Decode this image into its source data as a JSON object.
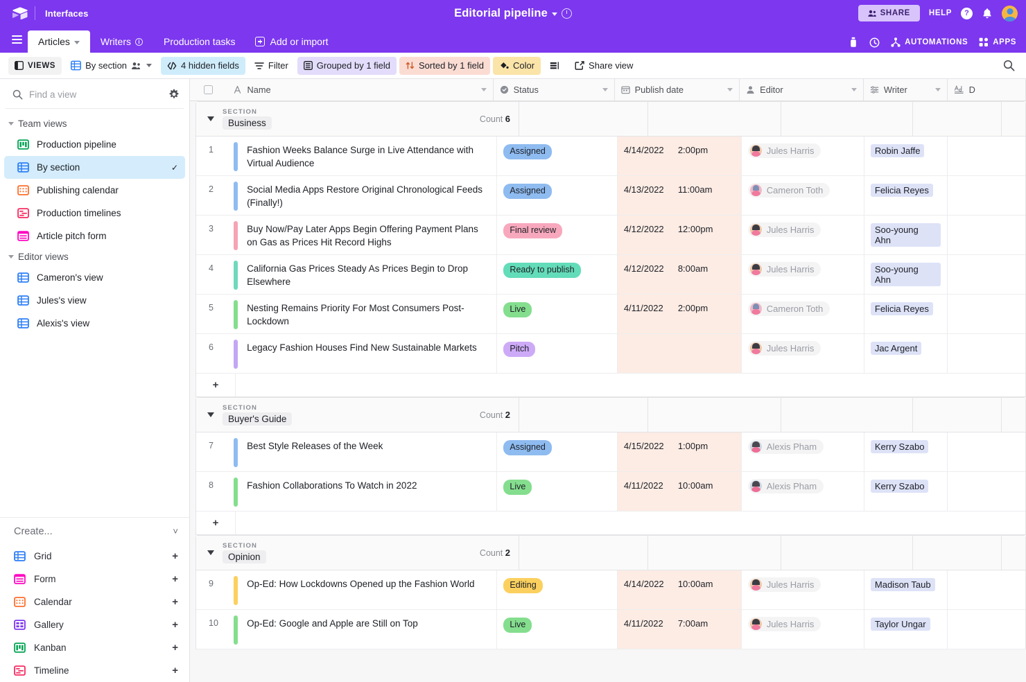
{
  "topbar": {
    "logo": "airtable-logo",
    "interfaces_label": "Interfaces",
    "doc_title": "Editorial pipeline",
    "share_label": "SHARE",
    "help_label": "HELP"
  },
  "tabs": {
    "items": [
      {
        "label": "Articles",
        "active": true,
        "caret": true
      },
      {
        "label": "Writers",
        "active": false,
        "info": true
      },
      {
        "label": "Production tasks",
        "active": false
      }
    ],
    "add_or_import": "Add or import",
    "right_items": [
      {
        "label": "AUTOMATIONS",
        "icon": "automations-icon"
      },
      {
        "label": "APPS",
        "icon": "apps-icon"
      }
    ]
  },
  "toolbar": {
    "views_label": "VIEWS",
    "current_view": "By section",
    "hidden_fields": "4 hidden fields",
    "filter": "Filter",
    "grouped": "Grouped by 1 field",
    "sorted": "Sorted by 1 field",
    "color": "Color",
    "row_height": "row-height-icon",
    "share_view": "Share view",
    "search": "search-icon"
  },
  "sidebar": {
    "search_placeholder": "Find a view",
    "gear": "gear-icon",
    "groups": [
      {
        "title": "Team views",
        "items": [
          {
            "label": "Production pipeline",
            "icon": "kanban-icon",
            "selected": false
          },
          {
            "label": "By section",
            "icon": "grid-icon",
            "selected": true
          },
          {
            "label": "Publishing calendar",
            "icon": "calendar-icon",
            "selected": false
          },
          {
            "label": "Production timelines",
            "icon": "timeline-icon",
            "selected": false
          },
          {
            "label": "Article pitch form",
            "icon": "form-icon",
            "selected": false
          }
        ]
      },
      {
        "title": "Editor views",
        "items": [
          {
            "label": "Cameron's view",
            "icon": "grid-icon",
            "selected": false
          },
          {
            "label": "Jules's view",
            "icon": "grid-icon",
            "selected": false
          },
          {
            "label": "Alexis's view",
            "icon": "grid-icon",
            "selected": false
          }
        ]
      }
    ],
    "create": {
      "title": "Create...",
      "items": [
        {
          "label": "Grid",
          "icon": "grid-icon"
        },
        {
          "label": "Form",
          "icon": "form-icon"
        },
        {
          "label": "Calendar",
          "icon": "calendar-icon"
        },
        {
          "label": "Gallery",
          "icon": "gallery-icon"
        },
        {
          "label": "Kanban",
          "icon": "kanban-icon"
        },
        {
          "label": "Timeline",
          "icon": "timeline-icon"
        }
      ]
    }
  },
  "grid": {
    "columns": [
      {
        "key": "name",
        "label": "Name",
        "icon": "text-field-icon"
      },
      {
        "key": "status",
        "label": "Status",
        "icon": "select-field-icon"
      },
      {
        "key": "date",
        "label": "Publish date",
        "icon": "date-field-icon"
      },
      {
        "key": "editor",
        "label": "Editor",
        "icon": "user-field-icon"
      },
      {
        "key": "writer",
        "label": "Writer",
        "icon": "link-field-icon"
      },
      {
        "key": "desc",
        "label": "D",
        "icon": "longtext-field-icon"
      }
    ],
    "group_field_label": "SECTION",
    "count_label": "Count",
    "add_row_label": "+",
    "sections": [
      {
        "name": "Business",
        "count": "6",
        "rows": [
          {
            "num": "1",
            "bar": "#8ebbf0",
            "name": "Fashion Weeks Balance Surge in Live Attendance with Virtual Audience",
            "status": "Assigned",
            "status_bg": "#8ebbf0",
            "date": "4/14/2022",
            "time": "2:00pm",
            "editor": "Jules Harris",
            "writer": "Robin Jaffe"
          },
          {
            "num": "2",
            "bar": "#8ebbf0",
            "name": "Social Media Apps Restore Original Chronological Feeds (Finally!)",
            "status": "Assigned",
            "status_bg": "#8ebbf0",
            "date": "4/13/2022",
            "time": "11:00am",
            "editor": "Cameron Toth",
            "writer": "Felicia Reyes"
          },
          {
            "num": "3",
            "bar": "#f6a3b4",
            "name": "Buy Now/Pay Later Apps Begin Offering Payment Plans on Gas as Prices Hit Record Highs",
            "status": "Final review",
            "status_bg": "#f8a8bd",
            "date": "4/12/2022",
            "time": "12:00pm",
            "editor": "Jules Harris",
            "writer": "Soo-young Ahn"
          },
          {
            "num": "4",
            "bar": "#6fd9bd",
            "name": "California Gas Prices Steady As Prices Begin to Drop Elsewhere",
            "status": "Ready to publish",
            "status_bg": "#63dcb9",
            "date": "4/12/2022",
            "time": "8:00am",
            "editor": "Jules Harris",
            "writer": "Soo-young Ahn"
          },
          {
            "num": "5",
            "bar": "#84de8e",
            "name": "Nesting Remains Priority For Most Consumers Post-Lockdown",
            "status": "Live",
            "status_bg": "#84de8e",
            "date": "4/11/2022",
            "time": "2:00pm",
            "editor": "Cameron Toth",
            "writer": "Felicia Reyes"
          },
          {
            "num": "6",
            "bar": "#c3a6f5",
            "name": "Legacy Fashion Houses Find New Sustainable Markets",
            "status": "Pitch",
            "status_bg": "#cdaaf7",
            "date": "",
            "time": "",
            "editor": "Jules Harris",
            "writer": "Jac Argent"
          }
        ]
      },
      {
        "name": "Buyer's Guide",
        "count": "2",
        "rows": [
          {
            "num": "7",
            "bar": "#8ebbf0",
            "name": "Best Style Releases of the Week",
            "status": "Assigned",
            "status_bg": "#8ebbf0",
            "date": "4/15/2022",
            "time": "1:00pm",
            "editor": "Alexis Pham",
            "writer": "Kerry Szabo"
          },
          {
            "num": "8",
            "bar": "#84de8e",
            "name": "Fashion Collaborations To Watch in 2022",
            "status": "Live",
            "status_bg": "#84de8e",
            "date": "4/11/2022",
            "time": "10:00am",
            "editor": "Alexis Pham",
            "writer": "Kerry Szabo"
          }
        ]
      },
      {
        "name": "Opinion",
        "count": "2",
        "rows": [
          {
            "num": "9",
            "bar": "#fbd05e",
            "name": "Op-Ed: How Lockdowns Opened up the Fashion World",
            "status": "Editing",
            "status_bg": "#fbd05e",
            "date": "4/14/2022",
            "time": "10:00am",
            "editor": "Jules Harris",
            "writer": "Madison Taub"
          },
          {
            "num": "10",
            "bar": "#84de8e",
            "name": "Op-Ed: Google and Apple are Still on Top",
            "status": "Live",
            "status_bg": "#84de8e",
            "date": "4/11/2022",
            "time": "7:00am",
            "editor": "Jules Harris",
            "writer": "Taylor Ungar"
          }
        ]
      }
    ]
  },
  "colors": {
    "brand_purple": "#7c37ef",
    "selected_view": "#d4ecfb",
    "date_column_bg": "#fdece4",
    "writer_pill": "#dde2f7"
  }
}
